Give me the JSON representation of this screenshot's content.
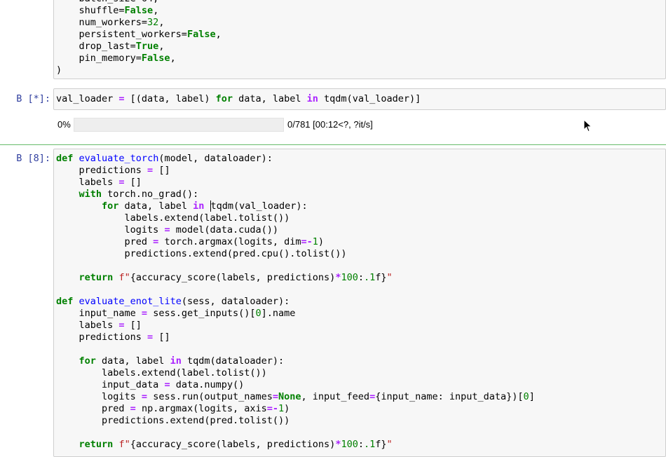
{
  "cell_top": {
    "code_lines": [
      "    shuffle=False,",
      "    num_workers=32,",
      "    persistent_workers=False,",
      "    drop_last=True,",
      "    pin_memory=False,",
      ")"
    ]
  },
  "cell_running": {
    "prompt": "В [*]:",
    "code": "val_loader = [(data, label) for data, label in tqdm(val_loader)]",
    "progress": {
      "percent_label": "0%",
      "fraction": 0.0,
      "info": "0/781 [00:12<?, ?it/s]"
    }
  },
  "cell_selected": {
    "prompt": "В [8]:"
  },
  "colors": {
    "prompt": "#303f9f",
    "keyword": "#008000",
    "operator": "#aa22ff",
    "function_name": "#0000ff",
    "string": "#ba2121",
    "selected_border": "#66bb6a"
  }
}
